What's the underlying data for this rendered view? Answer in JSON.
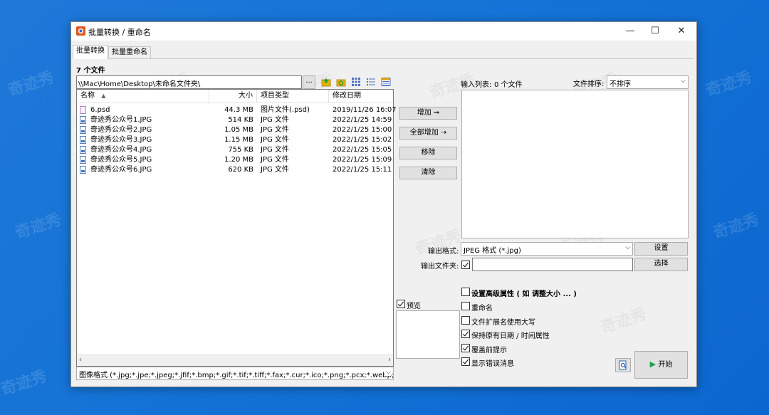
{
  "window": {
    "title": "批量转换 / 重命名"
  },
  "tabs": [
    {
      "label": "批量转换"
    },
    {
      "label": "批量重命名"
    }
  ],
  "left": {
    "file_count": "7 个文件",
    "path": "\\\\Mac\\Home\\Desktop\\未命名文件夹\\",
    "browse_label": "...",
    "columns": {
      "name": "名称",
      "size": "大小",
      "type": "项目类型",
      "date": "修改日期"
    },
    "files": [
      {
        "name": "6.psd",
        "size": "44.3 MB",
        "type": "图片文件(.psd)",
        "date": "2019/11/26 16:07"
      },
      {
        "name": "奇迹秀公众号1.JPG",
        "size": "514 KB",
        "type": "JPG 文件",
        "date": "2022/1/25 14:59"
      },
      {
        "name": "奇迹秀公众号2.JPG",
        "size": "1.05 MB",
        "type": "JPG 文件",
        "date": "2022/1/25 15:00"
      },
      {
        "name": "奇迹秀公众号3.JPG",
        "size": "1.15 MB",
        "type": "JPG 文件",
        "date": "2022/1/25 15:02"
      },
      {
        "name": "奇迹秀公众号4.JPG",
        "size": "755 KB",
        "type": "JPG 文件",
        "date": "2022/1/25 15:05"
      },
      {
        "name": "奇迹秀公众号5.JPG",
        "size": "1.20 MB",
        "type": "JPG 文件",
        "date": "2022/1/25 15:09"
      },
      {
        "name": "奇迹秀公众号6.JPG",
        "size": "620 KB",
        "type": "JPG 文件",
        "date": "2022/1/25 15:11"
      }
    ],
    "filter": "图像格式 (*.jpg;*.jpe;*.jpeg;*.jfif;*.bmp;*.gif;*.tif;*.tiff;*.fax;*.cur;*.ico;*.png;*.pcx;*.webp;*.heic"
  },
  "middle": {
    "add_label": "增加",
    "add_all_label": "全部增加",
    "remove_label": "移除",
    "clear_label": "清除",
    "preview_label": "预览"
  },
  "right": {
    "input_list_label": "输入列表:",
    "input_list_count": "0 个文件",
    "sort_label": "文件排序:",
    "sort_value": "不排序",
    "output_format_label": "输出格式:",
    "output_format_value": "JPEG 格式 (*.jpg)",
    "settings_label": "设置",
    "output_folder_label": "输出文件夹:",
    "output_folder_value": "",
    "choose_label": "选择",
    "advanced_label": "设置高级属性 ( 如 调整大小 ... )",
    "options": [
      {
        "label": "重命名",
        "checked": false
      },
      {
        "label": "文件扩展名使用大写",
        "checked": false
      },
      {
        "label": "保持原有日期 / 时间属性",
        "checked": true
      },
      {
        "label": "覆盖前提示",
        "checked": true
      },
      {
        "label": "显示错误消息",
        "checked": true
      }
    ],
    "start_label": "开始"
  },
  "watermark": "奇迹秀",
  "colors": {
    "desktop": "#1473d6",
    "accent_green": "#1aa34a",
    "folder_yellow": "#e8b400"
  }
}
